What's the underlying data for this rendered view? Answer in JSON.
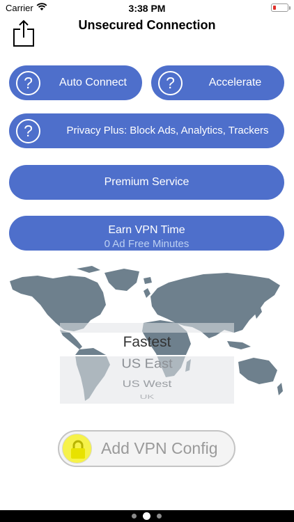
{
  "status_bar": {
    "carrier": "Carrier",
    "time": "3:38 PM",
    "battery_color": "#e0302a"
  },
  "nav": {
    "title": "Unsecured Connection",
    "share_icon": "share-icon"
  },
  "buttons": {
    "auto_connect": {
      "label": "Auto Connect",
      "help": "?"
    },
    "accelerate": {
      "label": "Accelerate",
      "help": "?"
    },
    "privacy_plus": {
      "label": "Privacy Plus: Block Ads, Analytics, Trackers",
      "help": "?"
    },
    "premium": {
      "label": "Premium Service"
    },
    "earn": {
      "label": "Earn VPN Time",
      "sublabel": "0 Ad Free Minutes"
    }
  },
  "server_picker": {
    "options": [
      "Fastest",
      "US East",
      "US West",
      "UK"
    ],
    "selected": "Fastest"
  },
  "add_config": {
    "label": "Add VPN Config",
    "icon": "lock-icon"
  },
  "page_indicator": {
    "count": 3,
    "active_index": 1
  },
  "colors": {
    "accent": "#4e6fcb",
    "map": "#6e808d",
    "lock": "#f6f24a"
  }
}
